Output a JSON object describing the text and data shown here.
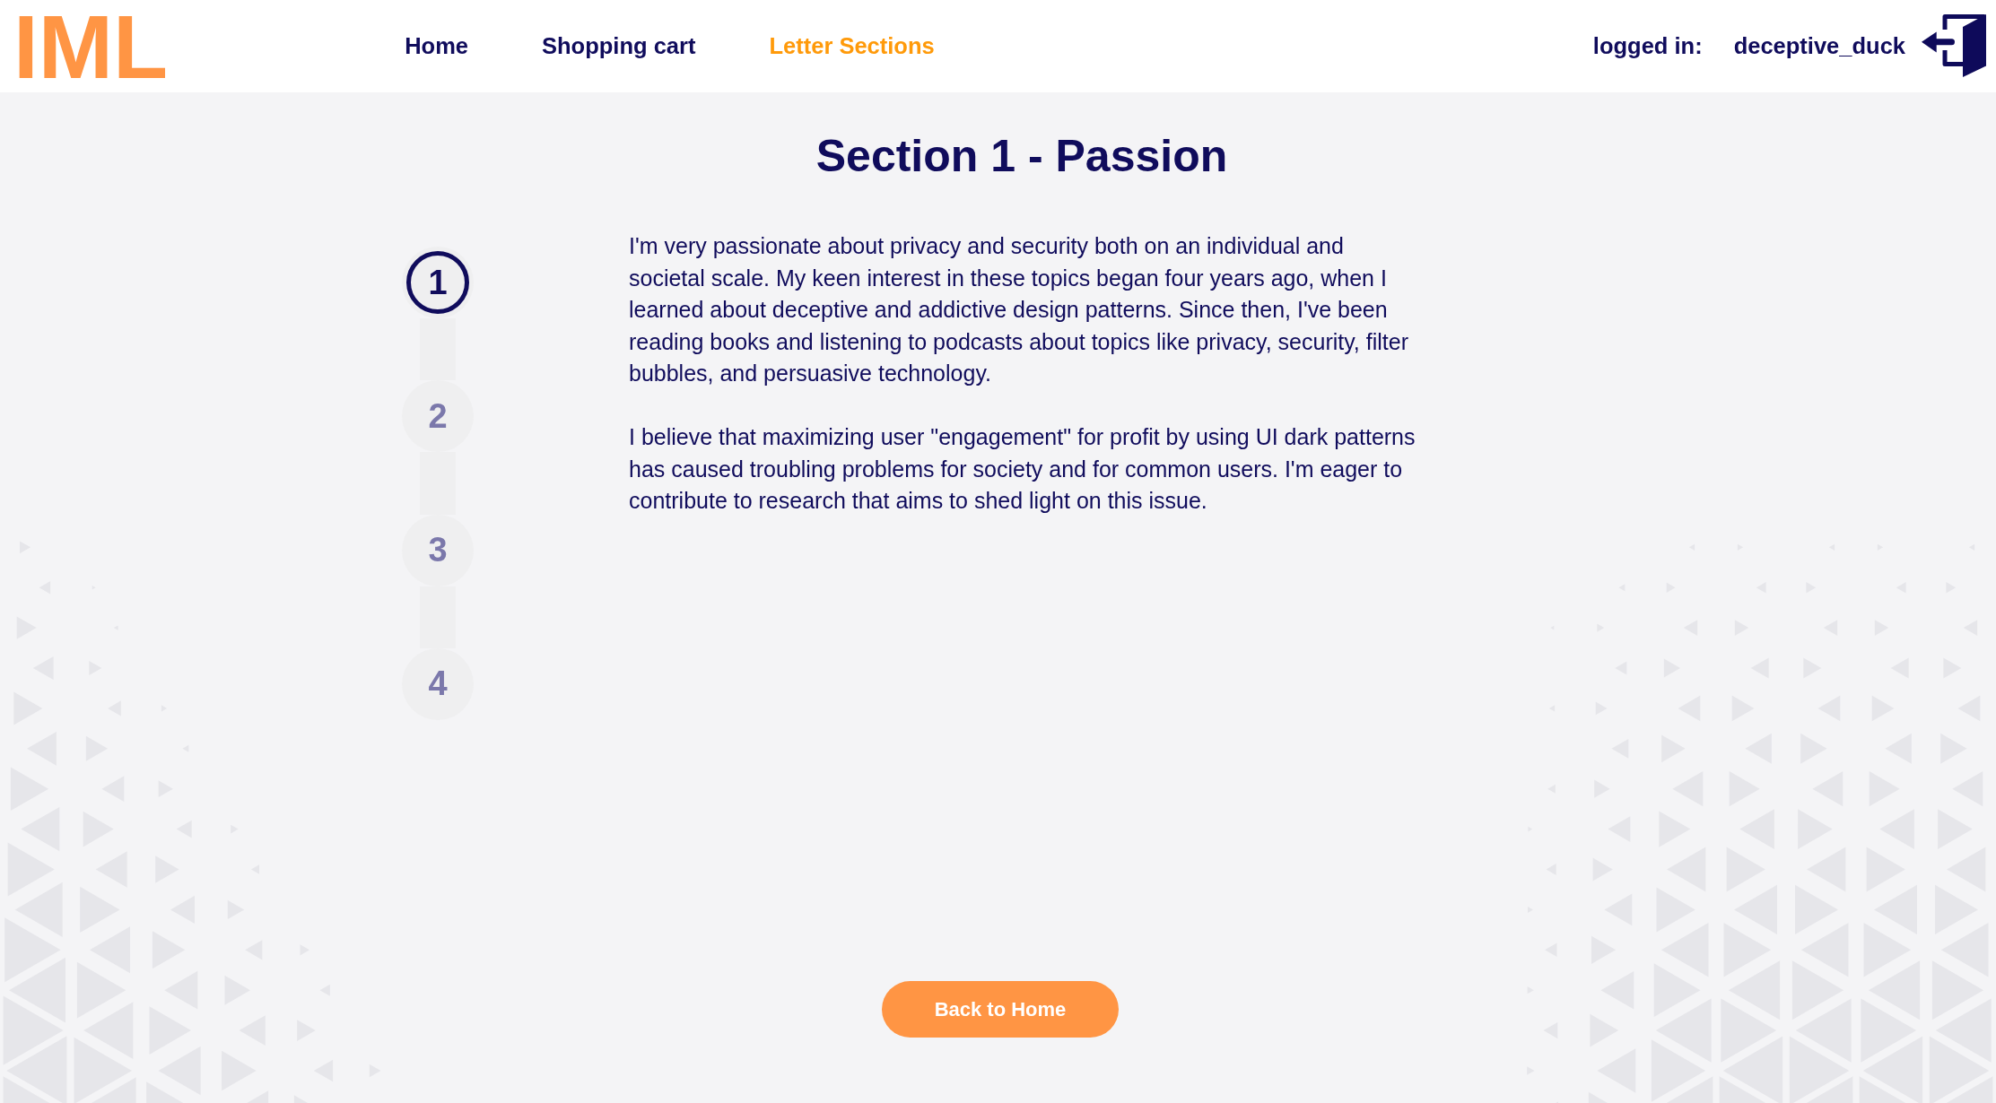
{
  "logo": "IML",
  "nav": [
    {
      "label": "Home",
      "selected": false
    },
    {
      "label": "Shopping cart",
      "selected": false
    },
    {
      "label": "Letter Sections",
      "selected": true
    }
  ],
  "user": {
    "label": "logged in:",
    "name": "deceptive_duck"
  },
  "section": {
    "title": "Section 1 - Passion",
    "steps": [
      {
        "label": "1",
        "selected": true
      },
      {
        "label": "2",
        "selected": false
      },
      {
        "label": "3",
        "selected": false
      },
      {
        "label": "4",
        "selected": false
      }
    ],
    "paragraphs": [
      "I'm very passionate about privacy and security both on an individual and\nsocietal scale. My keen interest in these topics began four years ago, when I\nlearned about deceptive and addictive design patterns. Since then, I've been\nreading books and listening to podcasts about topics like privacy, security, filter\nbubbles, and persuasive technology.",
      "I believe that maximizing user \"engagement\" for profit by using UI dark patterns\nhas caused troubling problems for society and for common users. I'm eager to\ncontribute to research that aims to shed light on this issue."
    ]
  },
  "back_button": {
    "label": "Back to Home"
  }
}
